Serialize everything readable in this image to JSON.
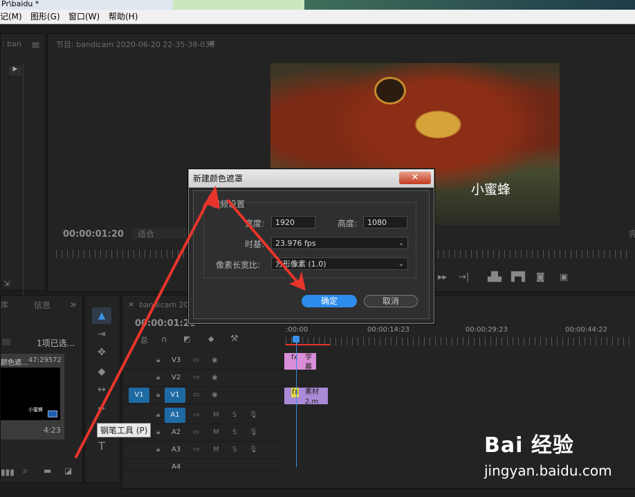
{
  "window": {
    "title": "Pr\\baidu *"
  },
  "menu": [
    "记(M)",
    "图形(G)",
    "窗口(W)",
    "帮助(H)"
  ],
  "left_panel": {
    "tab_partial": ": ban"
  },
  "program_monitor": {
    "title": "节目: bandicam 2020-06-20 22-35-38-036",
    "menu_icon": "≡",
    "timecode": "00:00:01:20",
    "fit_label": "适合",
    "right_partial": "完",
    "caption": "小蜜蜂"
  },
  "dialog": {
    "title": "新建颜色遮罩",
    "close_label": "✕",
    "group_label": "视频设置",
    "width_label": "宽度:",
    "width_value": "1920",
    "height_label": "高度:",
    "height_value": "1080",
    "timebase_label": "时基:",
    "timebase_value": "23.976 fps",
    "pixel_aspect_label": "像素长宽比:",
    "pixel_aspect_value": "方形像素 (1.0)",
    "ok_label": "确定",
    "cancel_label": "取消"
  },
  "project_panel": {
    "tab_partial": "库",
    "tab_info": "信息",
    "selection_count": "1项已选...",
    "clip_name_partial": "颜色遮...",
    "clip_meta": "47:29572",
    "thumb_caption": "小蜜蜂",
    "duration": "4:23"
  },
  "tooltip": "钢笔工具 (P)",
  "timeline": {
    "tab_label": "bandicam 2020",
    "timecode": "00:00:01:20",
    "ruler_labels": [
      ":00:00",
      "00:00:14:23",
      "00:00:29:23",
      "00:00:44:22"
    ],
    "tracks": [
      {
        "source": "",
        "name": "V3",
        "clip": "字幕"
      },
      {
        "source": "",
        "name": "V2",
        "clip": ""
      },
      {
        "source": "V1",
        "name": "V1",
        "clip": "素材2.m"
      },
      {
        "source": "",
        "name": "A1",
        "clip": ""
      },
      {
        "source": "",
        "name": "A2",
        "clip": ""
      },
      {
        "source": "",
        "name": "A3",
        "clip": ""
      },
      {
        "source": "",
        "name": "A4",
        "clip": ""
      }
    ],
    "mute_label": "M",
    "solo_label": "S"
  },
  "watermark": {
    "brand": "Bai 经验",
    "url": "jingyan.baidu.com"
  },
  "colors": {
    "accent_blue": "#2d8ceb",
    "track_highlight": "#1e6aa3",
    "clip_pink": "#d98ed8",
    "clip_purple": "#a98ad6",
    "arrow_red": "#e8352b"
  }
}
